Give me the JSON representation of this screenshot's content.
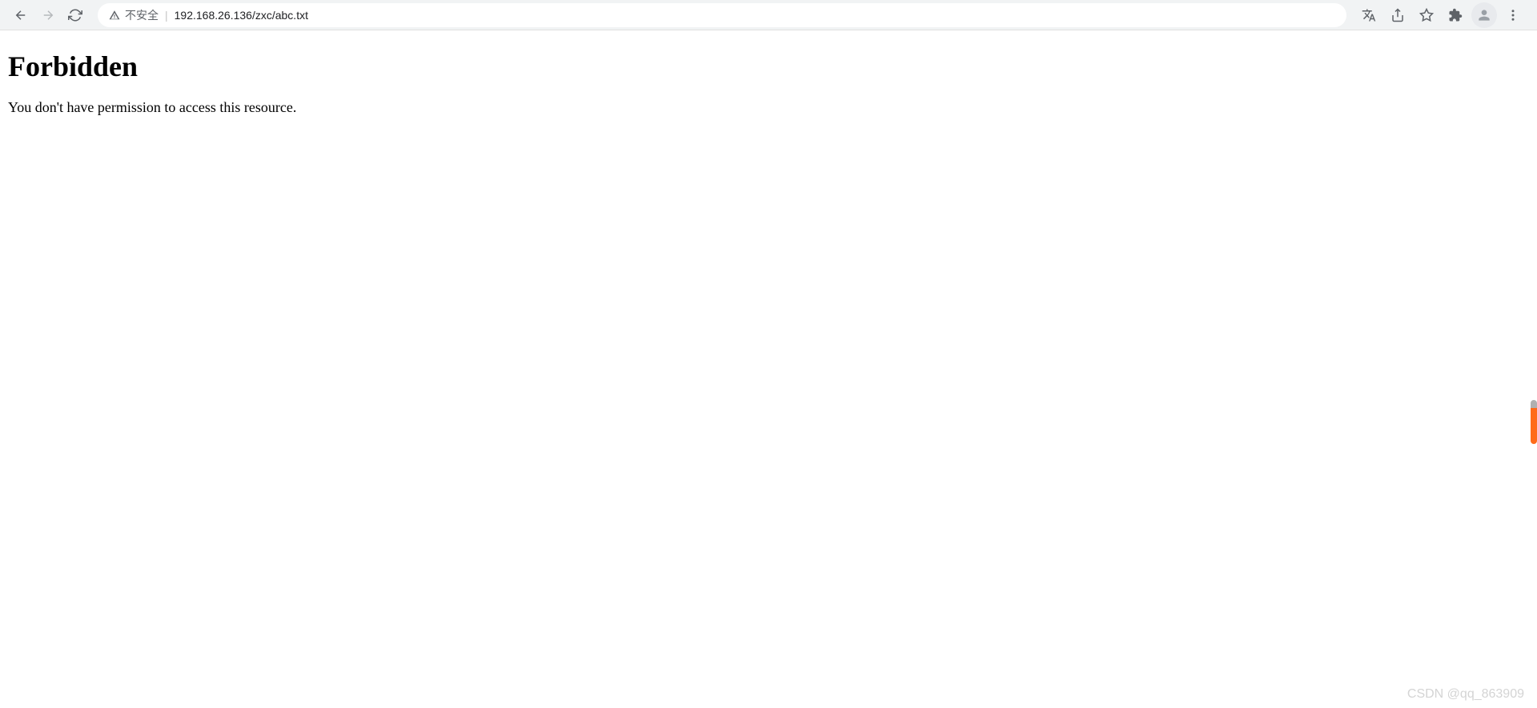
{
  "toolbar": {
    "insecure_label": "不安全",
    "url": "192.168.26.136/zxc/abc.txt"
  },
  "page": {
    "heading": "Forbidden",
    "message": "You don't have permission to access this resource."
  },
  "watermark": "CSDN @qq_863909"
}
